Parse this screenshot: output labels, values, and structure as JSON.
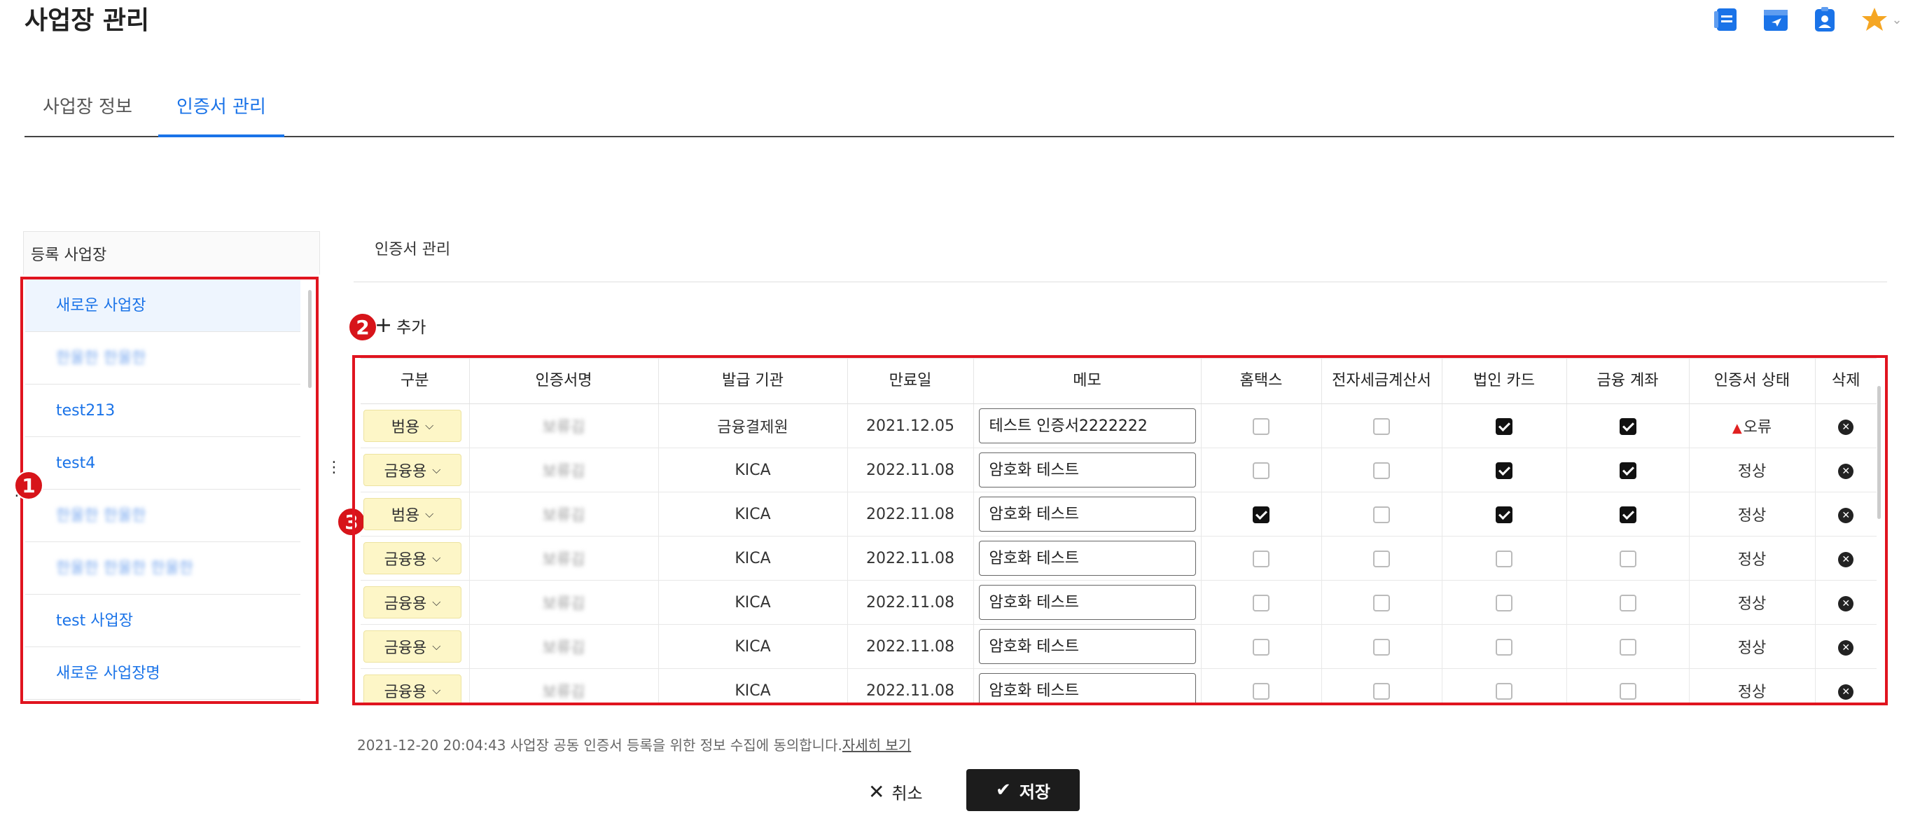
{
  "page": {
    "title": "사업장 관리",
    "tabs": [
      {
        "label": "사업장 정보",
        "active": false
      },
      {
        "label": "인증서 관리",
        "active": true
      }
    ],
    "top_icons": [
      "document-icon",
      "calendar-icon",
      "contact-icon",
      "star-icon"
    ],
    "star_color": "#f5a623",
    "accent_color": "#1a73e8"
  },
  "left_panel": {
    "header": "등록 사업장",
    "items": [
      {
        "label": "새로운 사업장",
        "selected": true,
        "blurred": false
      },
      {
        "label": "한울한 한울한",
        "selected": false,
        "blurred": true
      },
      {
        "label": "test213",
        "selected": false,
        "blurred": false
      },
      {
        "label": "test4",
        "selected": false,
        "blurred": false
      },
      {
        "label": "한울한 한울한",
        "selected": false,
        "blurred": true
      },
      {
        "label": "한울한 한울한 한울한",
        "selected": false,
        "blurred": true
      },
      {
        "label": "test 사업장",
        "selected": false,
        "blurred": false
      },
      {
        "label": "새로운 사업장명",
        "selected": false,
        "blurred": false
      }
    ]
  },
  "badges": [
    "1",
    "2",
    "3"
  ],
  "cert_section": {
    "title": "인증서 관리",
    "add_label": "추가",
    "columns": [
      "구분",
      "인증서명",
      "발급 기관",
      "만료일",
      "메모",
      "홈택스",
      "전자세금계산서",
      "법인 카드",
      "금융 계좌",
      "인증서 상태",
      "삭제"
    ],
    "rows": [
      {
        "type": "범용",
        "name": "보류김",
        "issuer": "금융결제원",
        "expiry": "2021.12.05",
        "memo": "테스트 인증서2222222",
        "hometax": false,
        "etax": false,
        "card": true,
        "account": true,
        "status": "오류",
        "error": true
      },
      {
        "type": "금융용",
        "name": "보류김",
        "issuer": "KICA",
        "expiry": "2022.11.08",
        "memo": "암호화 테스트",
        "hometax": false,
        "etax": false,
        "card": true,
        "account": true,
        "status": "정상",
        "error": false
      },
      {
        "type": "범용",
        "name": "보류김",
        "issuer": "KICA",
        "expiry": "2022.11.08",
        "memo": "암호화 테스트",
        "hometax": true,
        "etax": false,
        "card": true,
        "account": true,
        "status": "정상",
        "error": false
      },
      {
        "type": "금융용",
        "name": "보류김",
        "issuer": "KICA",
        "expiry": "2022.11.08",
        "memo": "암호화 테스트",
        "hometax": false,
        "etax": false,
        "card": false,
        "account": false,
        "status": "정상",
        "error": false
      },
      {
        "type": "금융용",
        "name": "보류김",
        "issuer": "KICA",
        "expiry": "2022.11.08",
        "memo": "암호화 테스트",
        "hometax": false,
        "etax": false,
        "card": false,
        "account": false,
        "status": "정상",
        "error": false
      },
      {
        "type": "금융용",
        "name": "보류김",
        "issuer": "KICA",
        "expiry": "2022.11.08",
        "memo": "암호화 테스트",
        "hometax": false,
        "etax": false,
        "card": false,
        "account": false,
        "status": "정상",
        "error": false
      },
      {
        "type": "금융용",
        "name": "보류김",
        "issuer": "KICA",
        "expiry": "2022.11.08",
        "memo": "암호화 테스트",
        "hometax": false,
        "etax": false,
        "card": false,
        "account": false,
        "status": "정상",
        "error": false
      }
    ]
  },
  "footer": {
    "consent_text": "2021-12-20 20:04:43 사업장 공동 인증서 등록을 위한 정보 수집에 동의합니다.",
    "consent_link": "자세히 보기",
    "cancel_label": "취소",
    "save_label": "저장"
  }
}
